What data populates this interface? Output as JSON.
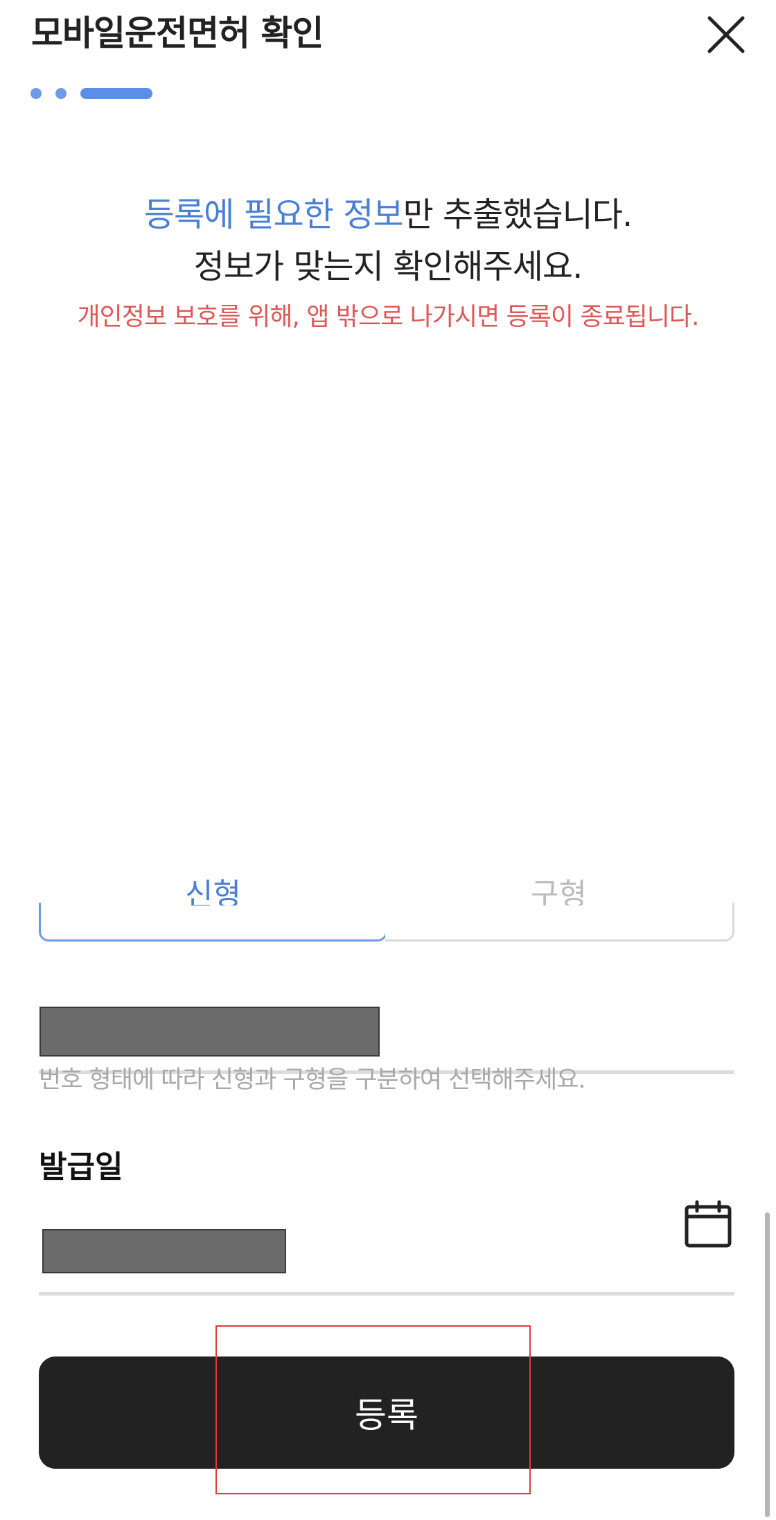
{
  "header": {
    "title": "모바일운전면허 확인",
    "close_icon": "close-icon"
  },
  "progress": {
    "total_steps": 3,
    "current_step": 3
  },
  "message": {
    "line1_accent": "등록에 필요한 정보",
    "line1_rest": "만 추출했습니다.",
    "line2": "정보가 맞는지 확인해주세요.",
    "warning": "개인정보 보호를 위해, 앱 밖으로 나가시면 등록이 종료됩니다."
  },
  "license_type": {
    "options": [
      "신형",
      "구형"
    ],
    "selected": "신형"
  },
  "license_number": {
    "hint": "번호 형태에 따라 신형과 구형을 구분하여 선택해주세요."
  },
  "issue_date": {
    "label": "발급일",
    "calendar_icon": "calendar-icon"
  },
  "submit": {
    "label": "등록"
  },
  "colors": {
    "accent": "#4a7fd6",
    "warning": "#e05757",
    "button_bg": "#222222"
  }
}
